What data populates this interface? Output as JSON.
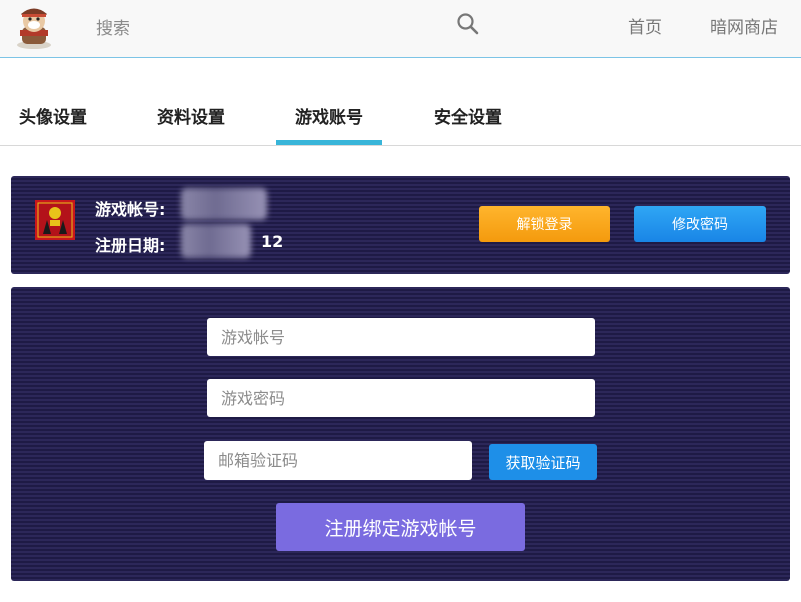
{
  "header": {
    "search_label": "搜索",
    "nav": {
      "home": "首页",
      "shop": "暗网商店"
    }
  },
  "tabs": [
    {
      "label": "头像设置"
    },
    {
      "label": "资料设置"
    },
    {
      "label": "游戏账号",
      "active": true
    },
    {
      "label": "安全设置"
    }
  ],
  "account": {
    "account_label": "游戏帐号:",
    "register_label": "注册日期:",
    "register_date_tail": "12",
    "unlock_button": "解锁登录",
    "change_password_button": "修改密码"
  },
  "form": {
    "account_placeholder": "游戏帐号",
    "password_placeholder": "游戏密码",
    "email_code_placeholder": "邮箱验证码",
    "get_code_button": "获取验证码",
    "submit_button": "注册绑定游戏帐号"
  },
  "colors": {
    "accent": "#38b5d9",
    "unlock": "#f7a41a",
    "primary": "#1e8fe8",
    "submit": "#7a6be0",
    "panel": "#25214f"
  }
}
